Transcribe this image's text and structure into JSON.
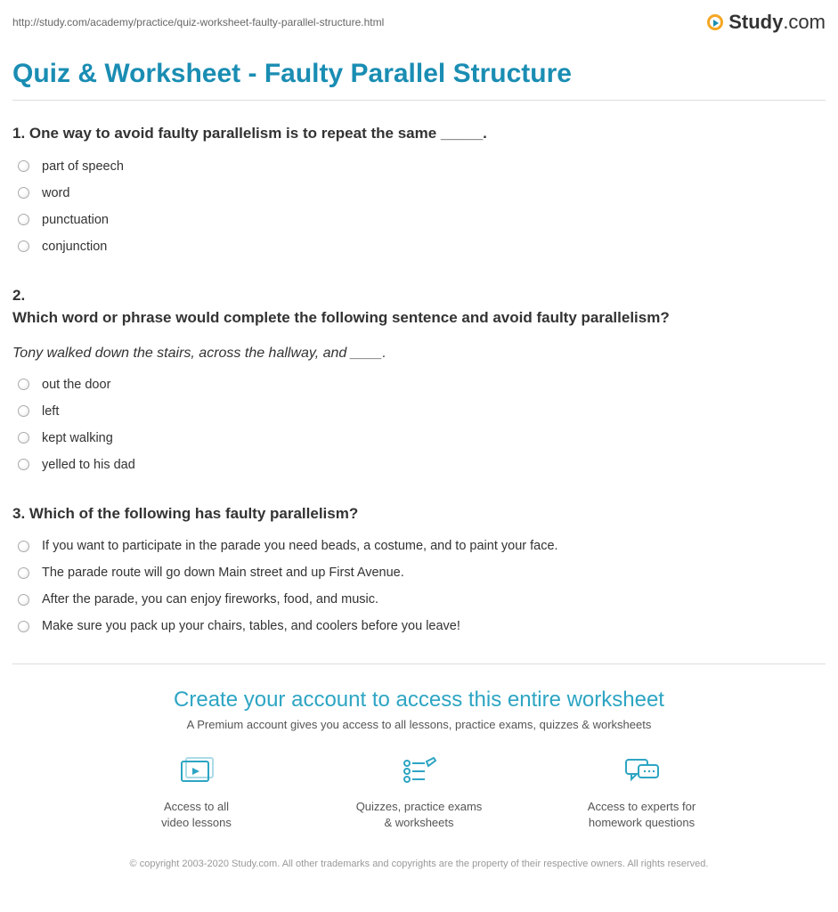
{
  "header": {
    "url": "http://study.com/academy/practice/quiz-worksheet-faulty-parallel-structure.html",
    "logo_text": "Study",
    "logo_suffix": ".com"
  },
  "title": "Quiz & Worksheet - Faulty Parallel Structure",
  "questions": [
    {
      "number": "1.",
      "text": "One way to avoid faulty parallelism is to repeat the same _____.",
      "italic": "",
      "options": [
        "part of speech",
        "word",
        "punctuation",
        "conjunction"
      ]
    },
    {
      "number": "2.",
      "text": "Which word or phrase would complete the following sentence and avoid faulty parallelism?",
      "italic": "Tony walked down the stairs, across the hallway, and ____.",
      "options": [
        "out the door",
        "left",
        "kept walking",
        "yelled to his dad"
      ]
    },
    {
      "number": "3.",
      "text": "Which of the following has faulty parallelism?",
      "italic": "",
      "options": [
        "If you want to participate in the parade you need beads, a costume, and to paint your face.",
        "The parade route will go down Main street and up First Avenue.",
        "After the parade, you can enjoy fireworks, food, and music.",
        "Make sure you pack up your chairs, tables, and coolers before you leave!"
      ]
    }
  ],
  "cta": {
    "title": "Create your account to access this entire worksheet",
    "subtitle": "A Premium account gives you access to all lessons, practice exams, quizzes & worksheets",
    "features": [
      {
        "line1": "Access to all",
        "line2": "video lessons"
      },
      {
        "line1": "Quizzes, practice exams",
        "line2": "& worksheets"
      },
      {
        "line1": "Access to experts for",
        "line2": "homework questions"
      }
    ]
  },
  "copyright": "© copyright 2003-2020 Study.com. All other trademarks and copyrights are the property of their respective owners. All rights reserved."
}
